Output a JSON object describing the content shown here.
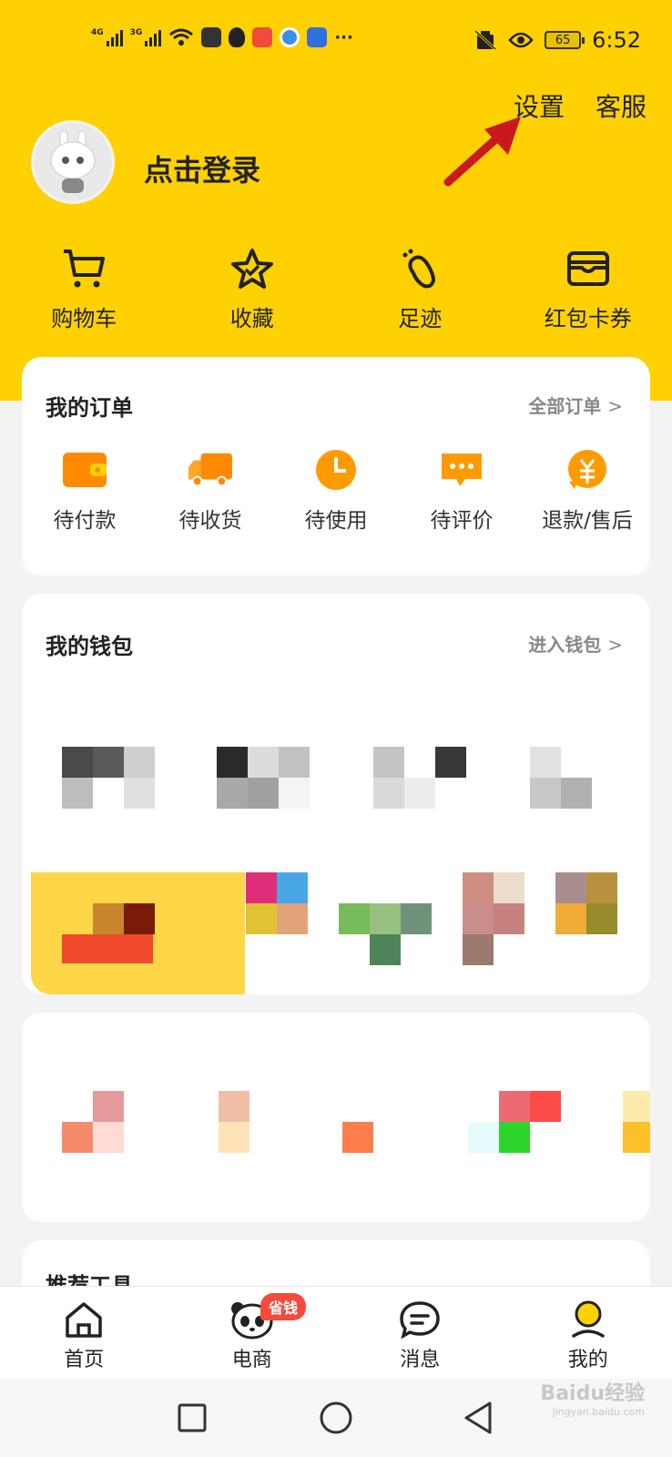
{
  "status_bar": {
    "signal1_label": "4G",
    "signal2_label": "3G",
    "dots": "···",
    "battery_level": "65",
    "time": "6:52",
    "app_icons": [
      "tv-icon",
      "qq-icon",
      "mail-icon",
      "browser-icon",
      "app-h-icon"
    ]
  },
  "header": {
    "settings_label": "设置",
    "service_label": "客服",
    "login_label": "点击登录"
  },
  "quick_links": [
    {
      "label": "购物车",
      "icon": "cart-icon"
    },
    {
      "label": "收藏",
      "icon": "star-icon"
    },
    {
      "label": "足迹",
      "icon": "footprint-icon"
    },
    {
      "label": "红包卡券",
      "icon": "wallet-card-icon"
    }
  ],
  "orders": {
    "title": "我的订单",
    "more_label": "全部订单",
    "items": [
      {
        "label": "待付款",
        "icon": "wallet-icon"
      },
      {
        "label": "待收货",
        "icon": "truck-icon"
      },
      {
        "label": "待使用",
        "icon": "clock-icon"
      },
      {
        "label": "待评价",
        "icon": "comment-icon"
      },
      {
        "label": "退款/售后",
        "icon": "refund-icon"
      }
    ]
  },
  "wallet": {
    "title": "我的钱包",
    "more_label": "进入钱包"
  },
  "tools": {
    "title": "推荐工具"
  },
  "tabbar": {
    "items": [
      {
        "label": "首页",
        "icon": "home-icon"
      },
      {
        "label": "电商",
        "icon": "panda-icon"
      },
      {
        "label": "消息",
        "icon": "message-icon"
      },
      {
        "label": "我的",
        "icon": "profile-icon"
      }
    ],
    "badge": "省钱"
  },
  "watermark": {
    "brand": "Baidu经验",
    "url": "jingyan.baidu.com"
  },
  "colors": {
    "brand_yellow": "#ffd100",
    "accent_orange": "#ff9a00",
    "badge_red": "#f44b3c",
    "arrow_red": "#c8191e"
  }
}
